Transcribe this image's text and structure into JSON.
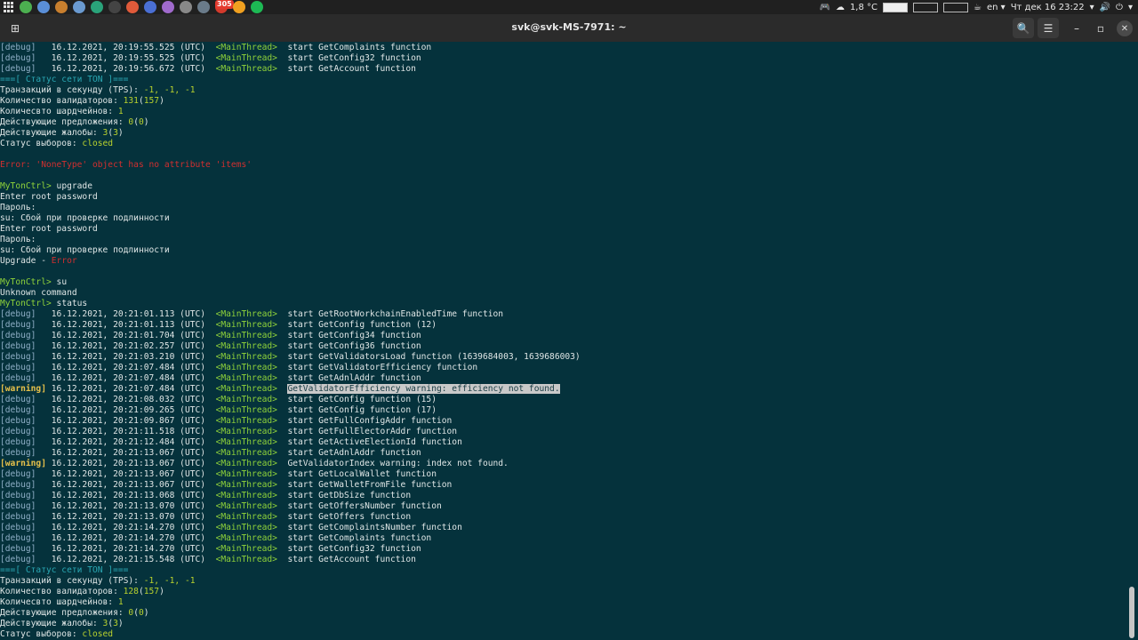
{
  "topbar": {
    "apps": [
      {
        "name": "chrome-icon",
        "color": "#4caf50"
      },
      {
        "name": "settings-icon",
        "color": "#5a8fd8"
      },
      {
        "name": "record-icon",
        "color": "#c87f2e"
      },
      {
        "name": "image-viewer-icon",
        "color": "#6a9ad0"
      },
      {
        "name": "monitor-icon",
        "color": "#2aa37a"
      },
      {
        "name": "terminal-icon",
        "color": "#444444"
      },
      {
        "name": "git-icon",
        "color": "#e05a3a"
      },
      {
        "name": "editor-icon",
        "color": "#4a6fd4"
      },
      {
        "name": "notes-icon",
        "color": "#a06acc"
      },
      {
        "name": "disk-icon",
        "color": "#888888"
      },
      {
        "name": "system-icon",
        "color": "#6a7b8a"
      },
      {
        "name": "mail-icon",
        "color": "#d33a2c",
        "badge": "305"
      },
      {
        "name": "app-orange-icon",
        "color": "#f0a020"
      },
      {
        "name": "spotify-icon",
        "color": "#1db954"
      }
    ],
    "weather": "1,8 °C",
    "lang": "en",
    "datetime": "Чт дек 16 23:22"
  },
  "window": {
    "title": "svk@svk-MS-7971: ~"
  },
  "terminal": {
    "lines": [
      [
        {
          "t": "[debug]",
          "c": "debug"
        },
        {
          "t": "   16.12.2021, 20:19:55.525 (UTC)  "
        },
        {
          "t": "<MainThread>",
          "c": "thread"
        },
        {
          "t": "  start GetComplaints function"
        }
      ],
      [
        {
          "t": "[debug]",
          "c": "debug"
        },
        {
          "t": "   16.12.2021, 20:19:55.525 (UTC)  "
        },
        {
          "t": "<MainThread>",
          "c": "thread"
        },
        {
          "t": "  start GetConfig32 function"
        }
      ],
      [
        {
          "t": "[debug]",
          "c": "debug"
        },
        {
          "t": "   16.12.2021, 20:19:56.672 (UTC)  "
        },
        {
          "t": "<MainThread>",
          "c": "thread"
        },
        {
          "t": "  start GetAccount function"
        }
      ],
      [
        {
          "t": "===[ Статус сети TON ]===",
          "c": "hdr"
        }
      ],
      [
        {
          "t": "Транзакций в секунду (TPS): "
        },
        {
          "t": "-1, -1, -1",
          "c": "num"
        }
      ],
      [
        {
          "t": "Количество валидаторов: "
        },
        {
          "t": "131",
          "c": "num"
        },
        {
          "t": "("
        },
        {
          "t": "157",
          "c": "num"
        },
        {
          "t": ")"
        }
      ],
      [
        {
          "t": "Количесвто шардчейнов: "
        },
        {
          "t": "1",
          "c": "num"
        }
      ],
      [
        {
          "t": "Действующие предложения: "
        },
        {
          "t": "0",
          "c": "num"
        },
        {
          "t": "("
        },
        {
          "t": "0",
          "c": "num"
        },
        {
          "t": ")"
        }
      ],
      [
        {
          "t": "Действующие жалобы: "
        },
        {
          "t": "3",
          "c": "num"
        },
        {
          "t": "("
        },
        {
          "t": "3",
          "c": "num"
        },
        {
          "t": ")"
        }
      ],
      [
        {
          "t": "Статус выборов: "
        },
        {
          "t": "closed",
          "c": "num"
        }
      ],
      [
        {
          "t": ""
        }
      ],
      [
        {
          "t": "Error: 'NoneType' object has no attribute 'items'",
          "c": "err"
        }
      ],
      [
        {
          "t": ""
        }
      ],
      [
        {
          "t": "MyTonCtrl>",
          "c": "prompt"
        },
        {
          "t": " upgrade"
        }
      ],
      [
        {
          "t": "Enter root password"
        }
      ],
      [
        {
          "t": "Пароль:"
        }
      ],
      [
        {
          "t": "su: Сбой при проверке подлинности"
        }
      ],
      [
        {
          "t": "Enter root password"
        }
      ],
      [
        {
          "t": "Пароль:"
        }
      ],
      [
        {
          "t": "su: Сбой при проверке подлинности"
        }
      ],
      [
        {
          "t": "Upgrade - "
        },
        {
          "t": "Error",
          "c": "err"
        }
      ],
      [
        {
          "t": ""
        }
      ],
      [
        {
          "t": "MyTonCtrl>",
          "c": "prompt"
        },
        {
          "t": " su"
        }
      ],
      [
        {
          "t": "Unknown command"
        }
      ],
      [
        {
          "t": "MyTonCtrl>",
          "c": "prompt"
        },
        {
          "t": " status"
        }
      ],
      [
        {
          "t": "[debug]",
          "c": "debug"
        },
        {
          "t": "   16.12.2021, 20:21:01.113 (UTC)  "
        },
        {
          "t": "<MainThread>",
          "c": "thread"
        },
        {
          "t": "  start GetRootWorkchainEnabledTime function"
        }
      ],
      [
        {
          "t": "[debug]",
          "c": "debug"
        },
        {
          "t": "   16.12.2021, 20:21:01.113 (UTC)  "
        },
        {
          "t": "<MainThread>",
          "c": "thread"
        },
        {
          "t": "  start GetConfig function (12)"
        }
      ],
      [
        {
          "t": "[debug]",
          "c": "debug"
        },
        {
          "t": "   16.12.2021, 20:21:01.704 (UTC)  "
        },
        {
          "t": "<MainThread>",
          "c": "thread"
        },
        {
          "t": "  start GetConfig34 function"
        }
      ],
      [
        {
          "t": "[debug]",
          "c": "debug"
        },
        {
          "t": "   16.12.2021, 20:21:02.257 (UTC)  "
        },
        {
          "t": "<MainThread>",
          "c": "thread"
        },
        {
          "t": "  start GetConfig36 function"
        }
      ],
      [
        {
          "t": "[debug]",
          "c": "debug"
        },
        {
          "t": "   16.12.2021, 20:21:03.210 (UTC)  "
        },
        {
          "t": "<MainThread>",
          "c": "thread"
        },
        {
          "t": "  start GetValidatorsLoad function (1639684003, 1639686003)"
        }
      ],
      [
        {
          "t": "[debug]",
          "c": "debug"
        },
        {
          "t": "   16.12.2021, 20:21:07.484 (UTC)  "
        },
        {
          "t": "<MainThread>",
          "c": "thread"
        },
        {
          "t": "  start GetValidatorEfficiency function"
        }
      ],
      [
        {
          "t": "[debug]",
          "c": "debug"
        },
        {
          "t": "   16.12.2021, 20:21:07.484 (UTC)  "
        },
        {
          "t": "<MainThread>",
          "c": "thread"
        },
        {
          "t": "  start GetAdnlAddr function"
        }
      ],
      [
        {
          "t": "[warning]",
          "c": "warn"
        },
        {
          "t": " 16.12.2021, 20:21:07.484 (UTC)  "
        },
        {
          "t": "<MainThread>",
          "c": "thread"
        },
        {
          "t": "  "
        },
        {
          "t": "GetValidatorEfficiency warning: efficiency not found.",
          "c": "hl"
        }
      ],
      [
        {
          "t": "[debug]",
          "c": "debug"
        },
        {
          "t": "   16.12.2021, 20:21:08.032 (UTC)  "
        },
        {
          "t": "<MainThread>",
          "c": "thread"
        },
        {
          "t": "  start GetConfig function (15)"
        }
      ],
      [
        {
          "t": "[debug]",
          "c": "debug"
        },
        {
          "t": "   16.12.2021, 20:21:09.265 (UTC)  "
        },
        {
          "t": "<MainThread>",
          "c": "thread"
        },
        {
          "t": "  start GetConfig function (17)"
        }
      ],
      [
        {
          "t": "[debug]",
          "c": "debug"
        },
        {
          "t": "   16.12.2021, 20:21:09.867 (UTC)  "
        },
        {
          "t": "<MainThread>",
          "c": "thread"
        },
        {
          "t": "  start GetFullConfigAddr function"
        }
      ],
      [
        {
          "t": "[debug]",
          "c": "debug"
        },
        {
          "t": "   16.12.2021, 20:21:11.518 (UTC)  "
        },
        {
          "t": "<MainThread>",
          "c": "thread"
        },
        {
          "t": "  start GetFullElectorAddr function"
        }
      ],
      [
        {
          "t": "[debug]",
          "c": "debug"
        },
        {
          "t": "   16.12.2021, 20:21:12.484 (UTC)  "
        },
        {
          "t": "<MainThread>",
          "c": "thread"
        },
        {
          "t": "  start GetActiveElectionId function"
        }
      ],
      [
        {
          "t": "[debug]",
          "c": "debug"
        },
        {
          "t": "   16.12.2021, 20:21:13.067 (UTC)  "
        },
        {
          "t": "<MainThread>",
          "c": "thread"
        },
        {
          "t": "  start GetAdnlAddr function"
        }
      ],
      [
        {
          "t": "[warning]",
          "c": "warn"
        },
        {
          "t": " 16.12.2021, 20:21:13.067 (UTC)  "
        },
        {
          "t": "<MainThread>",
          "c": "thread"
        },
        {
          "t": "  GetValidatorIndex warning: index not found."
        }
      ],
      [
        {
          "t": "[debug]",
          "c": "debug"
        },
        {
          "t": "   16.12.2021, 20:21:13.067 (UTC)  "
        },
        {
          "t": "<MainThread>",
          "c": "thread"
        },
        {
          "t": "  start GetLocalWallet function"
        }
      ],
      [
        {
          "t": "[debug]",
          "c": "debug"
        },
        {
          "t": "   16.12.2021, 20:21:13.067 (UTC)  "
        },
        {
          "t": "<MainThread>",
          "c": "thread"
        },
        {
          "t": "  start GetWalletFromFile function"
        }
      ],
      [
        {
          "t": "[debug]",
          "c": "debug"
        },
        {
          "t": "   16.12.2021, 20:21:13.068 (UTC)  "
        },
        {
          "t": "<MainThread>",
          "c": "thread"
        },
        {
          "t": "  start GetDbSize function"
        }
      ],
      [
        {
          "t": "[debug]",
          "c": "debug"
        },
        {
          "t": "   16.12.2021, 20:21:13.070 (UTC)  "
        },
        {
          "t": "<MainThread>",
          "c": "thread"
        },
        {
          "t": "  start GetOffersNumber function"
        }
      ],
      [
        {
          "t": "[debug]",
          "c": "debug"
        },
        {
          "t": "   16.12.2021, 20:21:13.070 (UTC)  "
        },
        {
          "t": "<MainThread>",
          "c": "thread"
        },
        {
          "t": "  start GetOffers function"
        }
      ],
      [
        {
          "t": "[debug]",
          "c": "debug"
        },
        {
          "t": "   16.12.2021, 20:21:14.270 (UTC)  "
        },
        {
          "t": "<MainThread>",
          "c": "thread"
        },
        {
          "t": "  start GetComplaintsNumber function"
        }
      ],
      [
        {
          "t": "[debug]",
          "c": "debug"
        },
        {
          "t": "   16.12.2021, 20:21:14.270 (UTC)  "
        },
        {
          "t": "<MainThread>",
          "c": "thread"
        },
        {
          "t": "  start GetComplaints function"
        }
      ],
      [
        {
          "t": "[debug]",
          "c": "debug"
        },
        {
          "t": "   16.12.2021, 20:21:14.270 (UTC)  "
        },
        {
          "t": "<MainThread>",
          "c": "thread"
        },
        {
          "t": "  start GetConfig32 function"
        }
      ],
      [
        {
          "t": "[debug]",
          "c": "debug"
        },
        {
          "t": "   16.12.2021, 20:21:15.548 (UTC)  "
        },
        {
          "t": "<MainThread>",
          "c": "thread"
        },
        {
          "t": "  start GetAccount function"
        }
      ],
      [
        {
          "t": "===[ Статус сети TON ]===",
          "c": "hdr"
        }
      ],
      [
        {
          "t": "Транзакций в секунду (TPS): "
        },
        {
          "t": "-1, -1, -1",
          "c": "num"
        }
      ],
      [
        {
          "t": "Количество валидаторов: "
        },
        {
          "t": "128",
          "c": "num"
        },
        {
          "t": "("
        },
        {
          "t": "157",
          "c": "num"
        },
        {
          "t": ")"
        }
      ],
      [
        {
          "t": "Количесвто шардчейнов: "
        },
        {
          "t": "1",
          "c": "num"
        }
      ],
      [
        {
          "t": "Действующие предложения: "
        },
        {
          "t": "0",
          "c": "num"
        },
        {
          "t": "("
        },
        {
          "t": "0",
          "c": "num"
        },
        {
          "t": ")"
        }
      ],
      [
        {
          "t": "Действующие жалобы: "
        },
        {
          "t": "3",
          "c": "num"
        },
        {
          "t": "("
        },
        {
          "t": "3",
          "c": "num"
        },
        {
          "t": ")"
        }
      ],
      [
        {
          "t": "Статус выборов: "
        },
        {
          "t": "closed",
          "c": "num"
        }
      ]
    ]
  }
}
